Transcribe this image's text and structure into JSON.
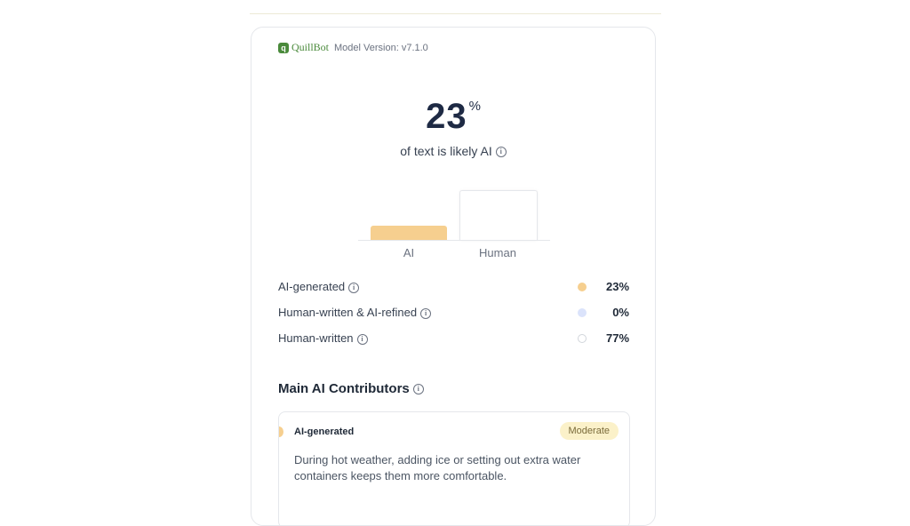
{
  "header": {
    "logo_text": "QuillBot",
    "model_version": "Model Version: v7.1.0"
  },
  "score": {
    "value": "23",
    "unit": "%",
    "subtitle": "of text is likely AI"
  },
  "chart_data": {
    "type": "bar",
    "categories": [
      "AI",
      "Human"
    ],
    "values": [
      23,
      77
    ],
    "colors": [
      "#f6cf8f",
      "#ffffff"
    ],
    "ylim": [
      0,
      77
    ]
  },
  "breakdown": [
    {
      "label": "AI-generated",
      "value": "23%",
      "color": "#f6cf8f"
    },
    {
      "label": "Human-written & AI-refined",
      "value": "0%",
      "color": "#dbe3fb"
    },
    {
      "label": "Human-written",
      "value": "77%",
      "color": "#ffffff"
    }
  ],
  "contributors": {
    "title": "Main AI Contributors",
    "item": {
      "type": "AI-generated",
      "badge": "Moderate",
      "text": "During hot weather, adding ice or setting out extra water containers keeps them more comfortable."
    }
  },
  "icons": {
    "info": "info-icon",
    "logo": "quillbot-logo-icon"
  }
}
